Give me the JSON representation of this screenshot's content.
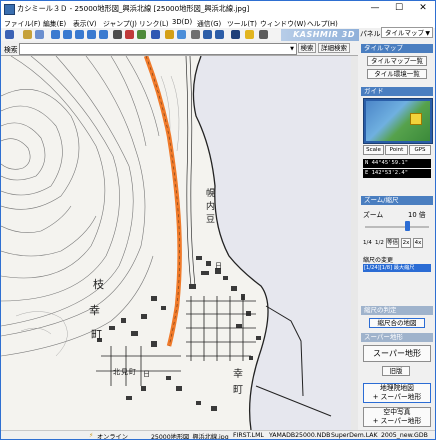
{
  "window": {
    "title": "カシミール３Ｄ - 25000地形図_興浜北線 [25000地形図_興浜北線.jpg]",
    "min_glyph": "—",
    "max_glyph": "☐",
    "close_glyph": "✕"
  },
  "menu": [
    "ファイル(F)",
    "編集(E)",
    "表示(V)",
    "ジャンプ(J)",
    "リンク(L)",
    "3D(D)",
    "通信(G)",
    "ツール(T)",
    "ウィンドウ(W)",
    "ヘルプ(H)"
  ],
  "panel_selector": {
    "label": "パネル",
    "value": "タイルマップ"
  },
  "toolbar": {
    "brand": "KASHMIR 3D"
  },
  "search": {
    "label": "検索",
    "value": "",
    "search_button": "検索",
    "detail_button": "詳細検索"
  },
  "map": {
    "labels": [
      "幌",
      "内",
      "豆",
      "枝",
      "幸",
      "町",
      "幸",
      "町",
      "日",
      "北",
      "見",
      "町",
      "日"
    ],
    "accent": "#f07a2a"
  },
  "panel": {
    "tilemap": {
      "header": "タイルマップ",
      "list_button": "タイルマップ一覧",
      "recent_button": "タイル環境一覧"
    },
    "guide": {
      "header": "ガイド",
      "tabs": [
        "Scale",
        "Point",
        "GPS"
      ]
    },
    "coords": {
      "lat": "N 44°45'59.1\"",
      "lon": "E 142°53'2.4\""
    },
    "zoom": {
      "header": "ズーム/縮尺",
      "label": "ズーム",
      "value": "10 倍",
      "buttons": [
        "1/4",
        "1/2",
        "等倍",
        "2x",
        "4x"
      ]
    },
    "scale_change": {
      "label": "縮尺の変更",
      "value": "[1/24][1/8] 最大縮尺"
    },
    "fit": {
      "header": "縮尺の判定",
      "button": "縮尺合の地図"
    },
    "super": {
      "header": "スーパー地形",
      "main_button": "スーパー地形",
      "old_button": "旧版",
      "combo1_line1": "地理院地図",
      "combo1_line2": "+ スーパー地形",
      "combo2_line1": "空中写真",
      "combo2_line2": "+ スーパー地形"
    }
  },
  "status": {
    "online": "オンライン",
    "map_file": "25000地形図_興浜北線.jpg",
    "lml": "FIRST.LML",
    "ndb": "YAMADB25000.NDB",
    "dem": "SuperDem.LAK",
    "gdb": "2005_new.GDB"
  },
  "colors": {
    "title_accent": "#2e6fd1",
    "panel_header": "#4a7ec0",
    "route_orange": "#f07a2a"
  }
}
